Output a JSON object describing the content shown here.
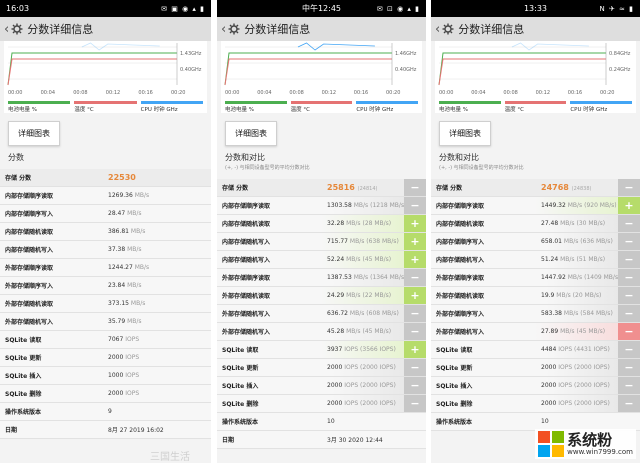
{
  "colors": {
    "battery": "#4caf50",
    "temperature": "#e57373",
    "cpu": "#42a5f5",
    "score": "#e6883a",
    "plus": "#b6dc6a",
    "minus": "#c7c7c7",
    "red": "#f08f8f"
  },
  "panels": [
    {
      "status_time": "16:03",
      "status_icons": "✉ ▣ ◉ ▴ ▮",
      "title": "分数详细信息",
      "chart_right_labels": [
        "1.43GHz",
        "0.40GHz"
      ],
      "chart_ticks": [
        "00:00",
        "00:04",
        "00:08",
        "00:12",
        "00:16",
        "00:20"
      ],
      "legend": [
        "电池电量 %",
        "温度 °C",
        "CPU 时钟 GHz"
      ],
      "detail_button": "详细图表",
      "section_title": "分数",
      "section_sub": "",
      "rows": [
        {
          "name": "存储 分数",
          "value": "22530",
          "unit": "",
          "score": true
        },
        {
          "name": "内部存储顺序读取",
          "value": "1269.36",
          "unit": "MB/s"
        },
        {
          "name": "内部存储顺序写入",
          "value": "28.47",
          "unit": "MB/s"
        },
        {
          "name": "内部存储随机读取",
          "value": "386.81",
          "unit": "MB/s"
        },
        {
          "name": "内部存储随机写入",
          "value": "37.38",
          "unit": "MB/s"
        },
        {
          "name": "外部存储顺序读取",
          "value": "1244.27",
          "unit": "MB/s"
        },
        {
          "name": "外部存储顺序写入",
          "value": "23.84",
          "unit": "MB/s"
        },
        {
          "name": "外部存储随机读取",
          "value": "373.15",
          "unit": "MB/s"
        },
        {
          "name": "外部存储随机写入",
          "value": "35.79",
          "unit": "MB/s"
        },
        {
          "name": "SQLite 读取",
          "value": "7067",
          "unit": "IOPS"
        },
        {
          "name": "SQLite 更新",
          "value": "2000",
          "unit": "IOPS"
        },
        {
          "name": "SQLite 插入",
          "value": "1000",
          "unit": "IOPS"
        },
        {
          "name": "SQLite 删除",
          "value": "2000",
          "unit": "IOPS"
        },
        {
          "name": "操作系统版本",
          "value": "9",
          "unit": ""
        },
        {
          "name": "日期",
          "value": "8月 27 2019 16:02",
          "unit": ""
        }
      ]
    },
    {
      "status_time": "中午12:45",
      "status_icons": "✉ ⊡ ◉ ▴ ▮",
      "title": "分数详细信息",
      "chart_right_labels": [
        "1.46GHz",
        "0.40GHz"
      ],
      "chart_ticks": [
        "00:00",
        "00:04",
        "00:08",
        "00:12",
        "00:16",
        "00:20"
      ],
      "legend": [
        "电池电量 %",
        "温度 °C",
        "CPU 时钟 GHz"
      ],
      "detail_button": "详细图表",
      "section_title": "分数和对比",
      "section_sub": "(+, -) 与相同设备型号的平均分数对比",
      "rows": [
        {
          "name": "存储 分数",
          "value": "25816",
          "ref": "(24814)",
          "score": true,
          "btn": "minus"
        },
        {
          "name": "内部存储顺序读取",
          "value": "1303.58",
          "unit": "MB/s",
          "ref": "(1218 MB/s)",
          "btn": "minus"
        },
        {
          "name": "内部存储随机读取",
          "value": "32.28",
          "unit": "MB/s",
          "ref": "(28 MB/s)",
          "btn": "plus"
        },
        {
          "name": "内部存储随机写入",
          "value": "715.77",
          "unit": "MB/s",
          "ref": "(638 MB/s)",
          "btn": "plus"
        },
        {
          "name": "内部存储随机写入",
          "value": "52.24",
          "unit": "MB/s",
          "ref": "(45 MB/s)",
          "btn": "plus"
        },
        {
          "name": "外部存储顺序读取",
          "value": "1387.53",
          "unit": "MB/s",
          "ref": "(1364 MB/s)",
          "btn": "minus"
        },
        {
          "name": "外部存储随机读取",
          "value": "24.29",
          "unit": "MB/s",
          "ref": "(22 MB/s)",
          "btn": "plus"
        },
        {
          "name": "外部存储随机写入",
          "value": "636.72",
          "unit": "MB/s",
          "ref": "(608 MB/s)",
          "btn": "minus"
        },
        {
          "name": "外部存储随机写入",
          "value": "45.28",
          "unit": "MB/s",
          "ref": "(45 MB/s)",
          "btn": "minus"
        },
        {
          "name": "SQLite 读取",
          "value": "3937",
          "unit": "IOPS",
          "ref": "(3566 IOPS)",
          "btn": "plus"
        },
        {
          "name": "SQLite 更新",
          "value": "2000",
          "unit": "IOPS",
          "ref": "(2000 IOPS)",
          "btn": "minus"
        },
        {
          "name": "SQLite 插入",
          "value": "2000",
          "unit": "IOPS",
          "ref": "(2000 IOPS)",
          "btn": "minus"
        },
        {
          "name": "SQLite 删除",
          "value": "2000",
          "unit": "IOPS",
          "ref": "(2000 IOPS)",
          "btn": "minus"
        },
        {
          "name": "操作系统版本",
          "value": "10",
          "unit": ""
        },
        {
          "name": "日期",
          "value": "3月 30 2020 12:44",
          "unit": ""
        }
      ]
    },
    {
      "status_time": "13:33",
      "status_icons": "N ✈ ≈ ▮",
      "title": "分数详细信息",
      "chart_right_labels": [
        "0.84GHz",
        "0.24GHz"
      ],
      "chart_ticks": [
        "00:00",
        "00:04",
        "00:08",
        "00:12",
        "00:16",
        "00:20"
      ],
      "legend": [
        "电池电量 %",
        "温度 °C",
        "CPU 时钟 GHz"
      ],
      "detail_button": "详细图表",
      "section_title": "分数和对比",
      "section_sub": "(+, -) 与相同设备型号的平均分数对比",
      "rows": [
        {
          "name": "存储 分数",
          "value": "24768",
          "ref": "(24838)",
          "score": true,
          "btn": "minus"
        },
        {
          "name": "内部存储顺序读取",
          "value": "1449.32",
          "unit": "MB/s",
          "ref": "(920 MB/s)",
          "btn": "plus"
        },
        {
          "name": "内部存储随机读取",
          "value": "27.48",
          "unit": "MB/s",
          "ref": "(30 MB/s)",
          "btn": "minus"
        },
        {
          "name": "内部存储顺序写入",
          "value": "658.01",
          "unit": "MB/s",
          "ref": "(636 MB/s)",
          "btn": "minus"
        },
        {
          "name": "内部存储随机写入",
          "value": "51.24",
          "unit": "MB/s",
          "ref": "(51 MB/s)",
          "btn": "minus"
        },
        {
          "name": "外部存储顺序读取",
          "value": "1447.92",
          "unit": "MB/s",
          "ref": "(1409 MB/s)",
          "btn": "minus"
        },
        {
          "name": "外部存储随机读取",
          "value": "19.9",
          "unit": "MB/s",
          "ref": "(20 MB/s)",
          "btn": "minus"
        },
        {
          "name": "外部存储顺序写入",
          "value": "583.38",
          "unit": "MB/s",
          "ref": "(584 MB/s)",
          "btn": "minus"
        },
        {
          "name": "外部存储随机写入",
          "value": "27.89",
          "unit": "MB/s",
          "ref": "(45 MB/s)",
          "btn": "red"
        },
        {
          "name": "SQLite 读取",
          "value": "4484",
          "unit": "IOPS",
          "ref": "(4431 IOPS)",
          "btn": "minus"
        },
        {
          "name": "SQLite 更新",
          "value": "2000",
          "unit": "IOPS",
          "ref": "(2000 IOPS)",
          "btn": "minus"
        },
        {
          "name": "SQLite 插入",
          "value": "2000",
          "unit": "IOPS",
          "ref": "(2000 IOPS)",
          "btn": "minus"
        },
        {
          "name": "SQLite 删除",
          "value": "2000",
          "unit": "IOPS",
          "ref": "(2000 IOPS)",
          "btn": "minus"
        },
        {
          "name": "操作系统版本",
          "value": "10",
          "unit": ""
        }
      ]
    }
  ],
  "watermark": "三国生活",
  "logo": {
    "text": "系统粉",
    "url": "www.win7999.com",
    "colors": [
      "#f25022",
      "#7fba00",
      "#00a4ef",
      "#ffb900"
    ]
  }
}
